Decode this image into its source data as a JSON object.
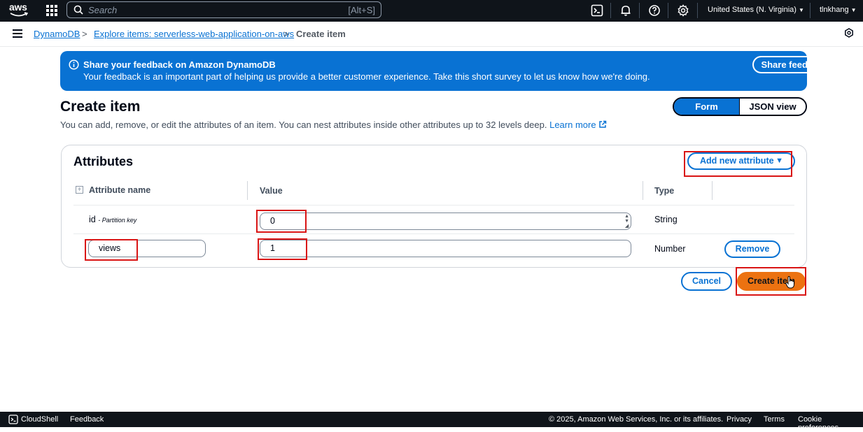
{
  "topbar": {
    "logo_text": "aws",
    "search_placeholder": "Search",
    "search_shortcut": "[Alt+S]",
    "region": "United States (N. Virginia)",
    "user": "tlnkhang",
    "icons": [
      "cloudshell-icon",
      "bell-icon",
      "help-icon",
      "gear-icon"
    ]
  },
  "breadcrumb": {
    "items": [
      "DynamoDB",
      "Explore items: serverless-web-application-on-aws",
      "Create item"
    ]
  },
  "flash": {
    "title": "Share your feedback on Amazon DynamoDB",
    "description": "Your feedback is an important part of helping us provide a better customer experience. Take this short survey to let us know how we're doing.",
    "button": "Share feedback",
    "color": "#0972d3"
  },
  "page": {
    "title": "Create item",
    "description": "You can add, remove, or edit the attributes of an item. You can nest attributes inside other attributes up to 32 levels deep.",
    "learn_more": "Learn more",
    "view_toggle": {
      "form": "Form",
      "json": "JSON view",
      "selected": "Form"
    }
  },
  "attributes": {
    "title": "Attributes",
    "add_button": "Add new attribute",
    "columns": [
      "Attribute name",
      "Value",
      "Type"
    ],
    "rows": [
      {
        "name": "id",
        "key_label": "- Partition key",
        "value": "0",
        "type": "String"
      },
      {
        "name": "views",
        "value": "1",
        "type": "Number",
        "action": "Remove"
      }
    ]
  },
  "actions": {
    "cancel": "Cancel",
    "create": "Create item",
    "primary_color": "#ec7211"
  },
  "footer": {
    "cloudshell": "CloudShell",
    "feedback": "Feedback",
    "copyright": "© 2025, Amazon Web Services, Inc. or its affiliates.",
    "privacy": "Privacy",
    "terms": "Terms",
    "cookies": "Cookie preferences"
  }
}
